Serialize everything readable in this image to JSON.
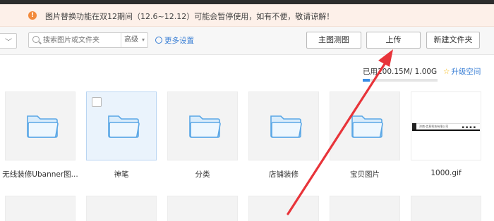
{
  "notice": {
    "text": "图片替换功能在双12期间（12.6~12.12）可能会暂停使用，如有不便，敬请谅解！"
  },
  "toolbar": {
    "search_placeholder": "搜索图片或文件夹",
    "advanced_label": "高级",
    "more_settings_label": "更多设置",
    "main_image_test_label": "主图测图",
    "upload_label": "上传",
    "new_folder_label": "新建文件夹"
  },
  "storage": {
    "used_prefix": "已用",
    "used_text": "100.15M/ 1.00G",
    "used_fraction": 0.098,
    "upgrade_label": "升级空间"
  },
  "items": [
    {
      "name": "无线装修Ubanner图...",
      "type": "folder",
      "selected": false
    },
    {
      "name": "神笔",
      "type": "folder",
      "selected": true
    },
    {
      "name": "分类",
      "type": "folder",
      "selected": false
    },
    {
      "name": "店铺装修",
      "type": "folder",
      "selected": false
    },
    {
      "name": "宝贝图片",
      "type": "folder",
      "selected": false
    },
    {
      "name": "1000.gif",
      "type": "image",
      "selected": false
    }
  ],
  "image_caption": "济南·信息科技有限公司",
  "colors": {
    "accent": "#3a7fd5",
    "folder": "#5aa7e6",
    "arrow": "#e8343a",
    "notice_bg": "#fdf0e9"
  }
}
